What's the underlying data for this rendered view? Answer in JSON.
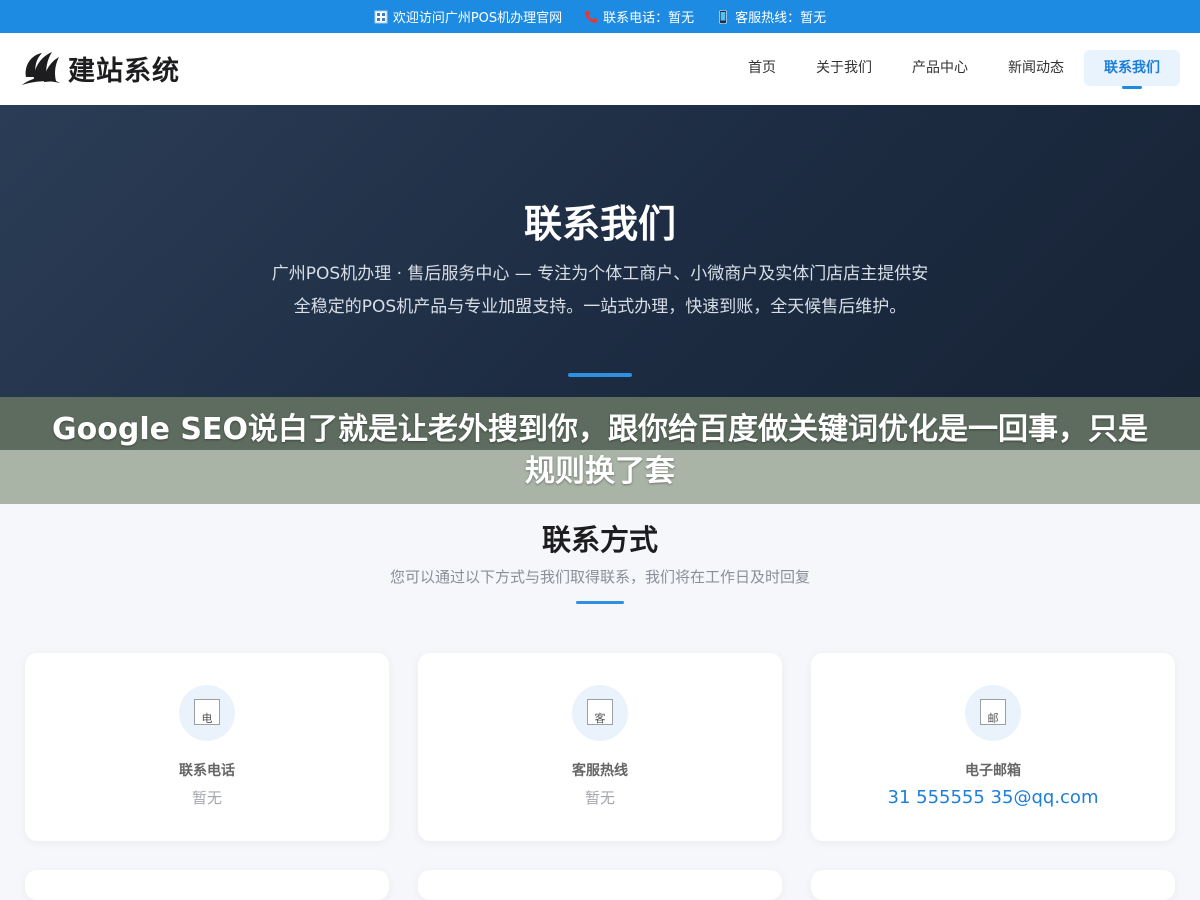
{
  "topbar": {
    "welcome": "欢迎访问广州POS机办理官网",
    "phone": "联系电话：暂无",
    "hotline": "客服热线：暂无"
  },
  "header": {
    "logo_text": "建站系统",
    "nav": [
      {
        "label": "首页"
      },
      {
        "label": "关于我们"
      },
      {
        "label": "产品中心"
      },
      {
        "label": "新闻动态"
      },
      {
        "label": "联系我们"
      }
    ]
  },
  "hero": {
    "title": "联系我们",
    "description": "广州POS机办理 · 售后服务中心 — 专注为个体工商户、小微商户及实体门店店主提供安全稳定的POS机产品与专业加盟支持。一站式办理，快速到账，全天候售后维护。"
  },
  "overlay": {
    "text": "Google SEO说白了就是让老外搜到你，跟你给百度做关键词优化是一回事，只是规则换了套"
  },
  "contact": {
    "title": "联系方式",
    "subtitle": "您可以通过以下方式与我们取得联系，我们将在工作日及时回复",
    "cards": [
      {
        "alt": "电",
        "label": "联系电话",
        "value": "暂无"
      },
      {
        "alt": "客",
        "label": "客服热线",
        "value": "暂无"
      },
      {
        "alt": "邮",
        "label": "电子邮箱",
        "value": "31 555555 35@qq.com"
      }
    ]
  },
  "colors": {
    "accent": "#1e8be3",
    "hero_bg": "#1d2c42",
    "link": "#1e7fd9"
  }
}
